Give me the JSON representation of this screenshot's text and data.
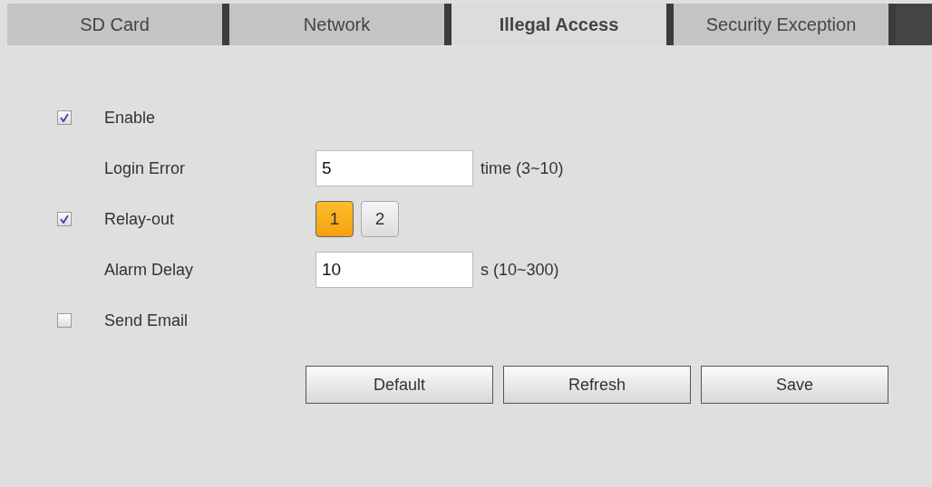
{
  "tabs": [
    {
      "label": "SD Card",
      "selected": false
    },
    {
      "label": "Network",
      "selected": false
    },
    {
      "label": "Illegal Access",
      "selected": true
    },
    {
      "label": "Security Exception",
      "selected": false
    }
  ],
  "rows": [
    {
      "kind": "checkbox",
      "label": "Enable",
      "checked": true
    },
    {
      "kind": "field",
      "label": "Login Error",
      "value": "5",
      "hint": "time (3~10)"
    },
    {
      "kind": "relay",
      "label": "Relay-out",
      "checked": true,
      "channels": [
        {
          "label": "1",
          "selected": true
        },
        {
          "label": "2",
          "selected": false
        }
      ]
    },
    {
      "kind": "field",
      "label": "Alarm Delay",
      "value": "10",
      "hint": "s (10~300)"
    },
    {
      "kind": "checkbox",
      "label": "Send Email",
      "checked": false
    }
  ],
  "buttons": [
    "Default",
    "Refresh",
    "Save"
  ]
}
